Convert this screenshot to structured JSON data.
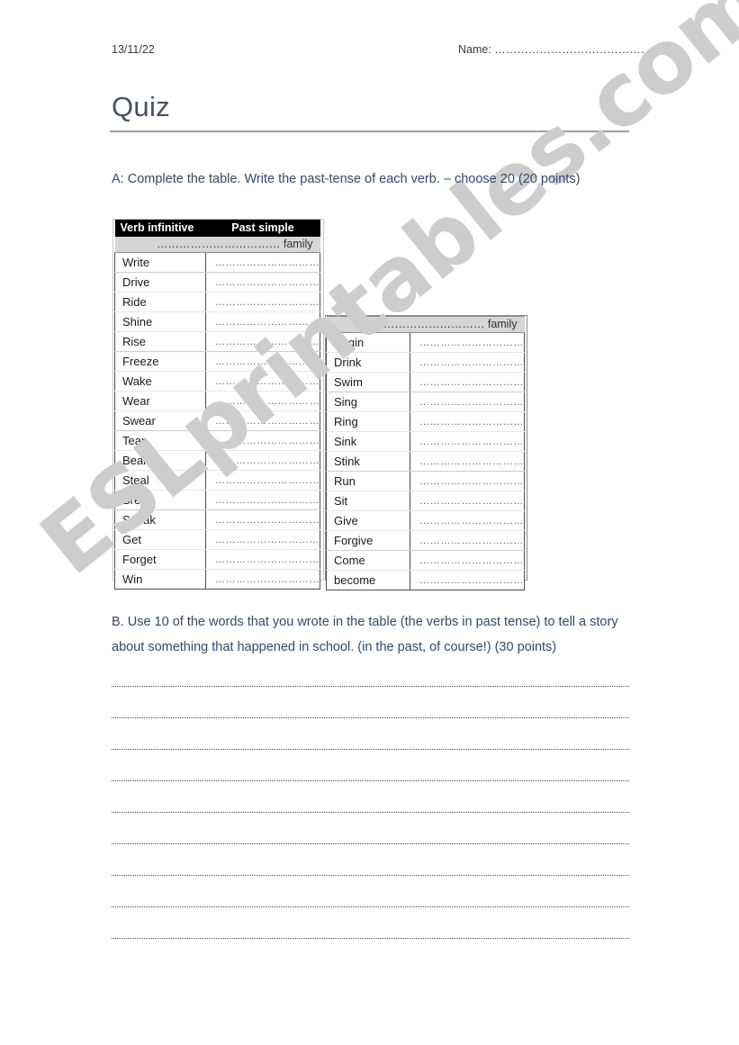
{
  "header": {
    "date": "13/11/22",
    "name_label": "Name: ………………………………………"
  },
  "title": "Quiz",
  "sections": {
    "a": {
      "instruction": "A:  Complete the table.   Write the past-tense of each verb.  – choose 20 (20 points)"
    },
    "b": {
      "instruction": "B.  Use 10 of the words that you wrote in the table (the verbs in past tense) to tell a story about something that happened in school.  (in the past, of course!) (30 points)"
    }
  },
  "table_one": {
    "columns": [
      "Verb infinitive",
      "Past simple"
    ],
    "family_label": "…………………………… family",
    "blank_answer": "…………………………",
    "rows": [
      {
        "verb": "Write",
        "group_end": true
      },
      {
        "verb": "Drive",
        "group_end": false
      },
      {
        "verb": "Ride",
        "group_end": false
      },
      {
        "verb": "Shine",
        "group_end": false
      },
      {
        "verb": "Rise",
        "group_end": true
      },
      {
        "verb": "Freeze",
        "group_end": false
      },
      {
        "verb": "Wake",
        "group_end": false
      },
      {
        "verb": "Wear",
        "group_end": false
      },
      {
        "verb": "Swear",
        "group_end": true
      },
      {
        "verb": "Tear",
        "group_end": false
      },
      {
        "verb": "Bear",
        "group_end": false
      },
      {
        "verb": "Steal",
        "group_end": false
      },
      {
        "verb": "Break",
        "group_end": true
      },
      {
        "verb": "Speak",
        "group_end": false
      },
      {
        "verb": "Get",
        "group_end": false
      },
      {
        "verb": "Forget",
        "group_end": false
      },
      {
        "verb": "Win",
        "group_end": false
      }
    ]
  },
  "table_two": {
    "family_label": "…………………………… family",
    "blank_answer": "…………………………",
    "rows": [
      {
        "verb": "Begin",
        "group_end": false
      },
      {
        "verb": "Drink",
        "group_end": false
      },
      {
        "verb": "Swim",
        "group_end": true
      },
      {
        "verb": "Sing",
        "group_end": false
      },
      {
        "verb": "Ring",
        "group_end": false
      },
      {
        "verb": "Sink",
        "group_end": false
      },
      {
        "verb": "Stink",
        "group_end": true
      },
      {
        "verb": "Run",
        "group_end": false
      },
      {
        "verb": "Sit",
        "group_end": false
      },
      {
        "verb": "Give",
        "group_end": false
      },
      {
        "verb": "Forgive",
        "group_end": true
      },
      {
        "verb": "Come",
        "group_end": false
      },
      {
        "verb": "become",
        "group_end": false
      }
    ]
  },
  "answer_lines": {
    "count": 9
  },
  "watermark": {
    "text": "ESLprintables.com",
    "color": "#cdcdcd"
  },
  "colors": {
    "instruction_text": "#2b4b7d",
    "title_text": "#46525d",
    "title_rule": "#92a3bb",
    "header_band": "#000000",
    "family_band": "#d6d6d6"
  }
}
